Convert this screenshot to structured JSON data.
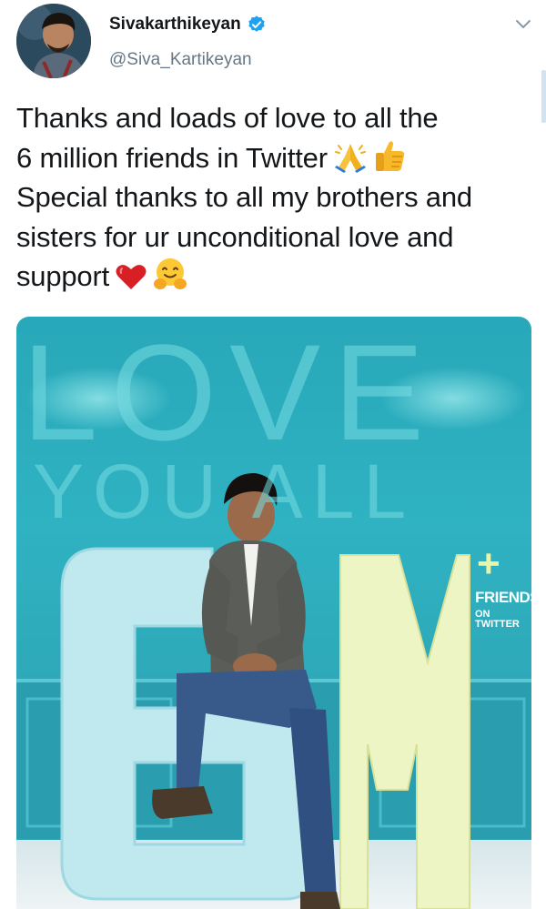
{
  "user": {
    "display_name": "Sivakarthikeyan",
    "handle": "@Siva_Kartikeyan",
    "verified": true,
    "accent_color": "#1da1f2"
  },
  "tweet": {
    "lines": [
      "Thanks and loads of love to all the",
      "6 million friends in Twitter",
      "Special thanks to all my brothers and",
      "sisters for ur unconditional love and",
      "support"
    ],
    "line2_emojis": [
      "folded-hands",
      "thumbs-up"
    ],
    "line5_emojis": [
      "red-heart",
      "hugging-face"
    ]
  },
  "media": {
    "text_love": "LOVE",
    "text_you_all": "YOU ALL",
    "count_text": "6M",
    "plus_text": "+",
    "friends_text": "FRIENDS",
    "on_twitter_text": "ON TWITTER",
    "background_color": "#2eacbd",
    "digit_color": "#bfe9ef",
    "letter_m_color": "#eef5c4"
  },
  "icons": {
    "verified": "verified-badge-icon",
    "menu": "chevron-down-icon"
  }
}
